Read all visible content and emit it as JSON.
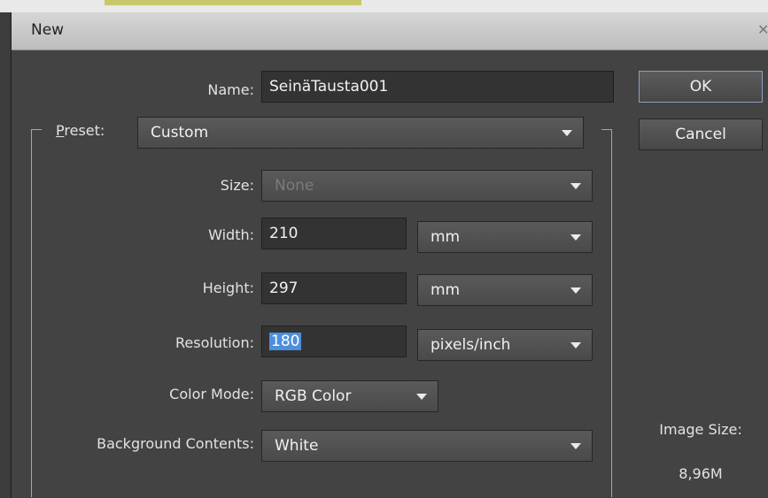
{
  "dialog": {
    "title": "New",
    "close_icon": "close-icon"
  },
  "name": {
    "label": "Name:",
    "value": "SeinäTausta001"
  },
  "preset": {
    "label_mnemonic": "P",
    "label_rest": "reset:",
    "value": "Custom"
  },
  "size": {
    "label": "Size:",
    "value": "None"
  },
  "width": {
    "label": "Width:",
    "value": "210",
    "unit": "mm"
  },
  "height": {
    "label": "Height:",
    "value": "297",
    "unit": "mm"
  },
  "resolution": {
    "label": "Resolution:",
    "value": "180",
    "unit": "pixels/inch"
  },
  "color_mode": {
    "label": "Color Mode:",
    "value": "RGB Color"
  },
  "background": {
    "label": "Background Contents:",
    "value": "White"
  },
  "buttons": {
    "ok": "OK",
    "cancel": "Cancel"
  },
  "image_size": {
    "label": "Image Size:",
    "value": "8,96M"
  }
}
